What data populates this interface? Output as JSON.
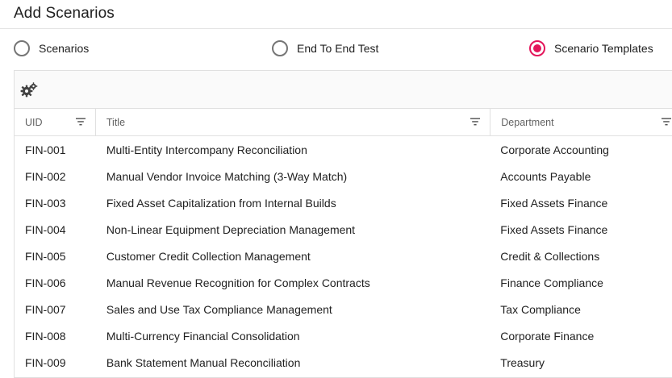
{
  "header": {
    "title": "Add Scenarios"
  },
  "radios": [
    {
      "label": "Scenarios",
      "selected": false
    },
    {
      "label": "End To End Test",
      "selected": false
    },
    {
      "label": "Scenario Templates",
      "selected": true
    }
  ],
  "colors": {
    "accent": "#e3165b"
  },
  "toolbar": {
    "icon": "gears-icon"
  },
  "table": {
    "columns": [
      "UID",
      "Title",
      "Department"
    ],
    "rows": [
      {
        "uid": "FIN-001",
        "title": "Multi-Entity Intercompany Reconciliation",
        "department": "Corporate Accounting"
      },
      {
        "uid": "FIN-002",
        "title": "Manual Vendor Invoice Matching (3-Way Match)",
        "department": "Accounts Payable"
      },
      {
        "uid": "FIN-003",
        "title": "Fixed Asset Capitalization from Internal Builds",
        "department": "Fixed Assets Finance"
      },
      {
        "uid": "FIN-004",
        "title": "Non-Linear Equipment Depreciation Management",
        "department": "Fixed Assets Finance"
      },
      {
        "uid": "FIN-005",
        "title": "Customer Credit Collection Management",
        "department": "Credit & Collections"
      },
      {
        "uid": "FIN-006",
        "title": "Manual Revenue Recognition for Complex Contracts",
        "department": "Finance Compliance"
      },
      {
        "uid": "FIN-007",
        "title": "Sales and Use Tax Compliance Management",
        "department": "Tax Compliance"
      },
      {
        "uid": "FIN-008",
        "title": "Multi-Currency Financial Consolidation",
        "department": "Corporate Finance"
      },
      {
        "uid": "FIN-009",
        "title": "Bank Statement Manual Reconciliation",
        "department": "Treasury"
      }
    ]
  }
}
